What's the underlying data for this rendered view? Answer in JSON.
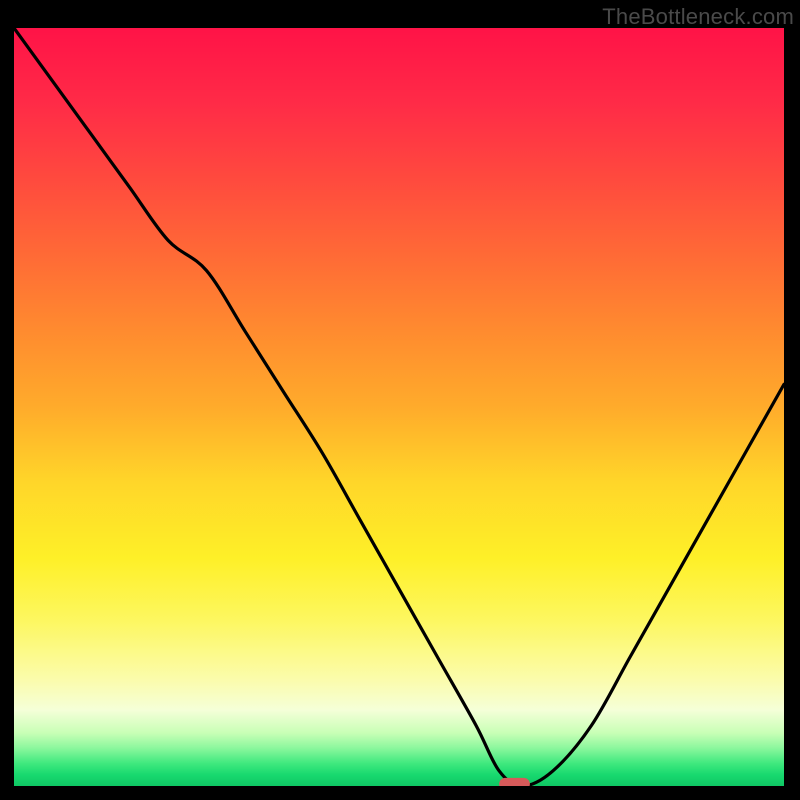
{
  "watermark": "TheBottleneck.com",
  "colors": {
    "frame_bg": "#000000",
    "curve_stroke": "#000000",
    "marker_fill": "#d65a5a",
    "gradient_stops": [
      "#ff1347",
      "#ff2b47",
      "#ff4a3e",
      "#ff6a36",
      "#ff8b2f",
      "#ffab2b",
      "#ffd629",
      "#fef028",
      "#fdf75f",
      "#fbfcac",
      "#f5ffd8",
      "#c8ffb6",
      "#8bf79d",
      "#40e97e",
      "#18d96f",
      "#0fc764"
    ]
  },
  "chart_data": {
    "type": "line",
    "title": "",
    "xlabel": "",
    "ylabel": "",
    "xlim": [
      0,
      100
    ],
    "ylim": [
      0,
      100
    ],
    "grid": false,
    "legend": null,
    "annotations": [],
    "series": [
      {
        "name": "bottleneck-curve",
        "x": [
          0,
          5,
          10,
          15,
          20,
          25,
          30,
          35,
          40,
          45,
          50,
          55,
          60,
          63,
          66,
          70,
          75,
          80,
          85,
          90,
          95,
          100
        ],
        "y": [
          100,
          93,
          86,
          79,
          72,
          68,
          60,
          52,
          44,
          35,
          26,
          17,
          8,
          2,
          0,
          2,
          8,
          17,
          26,
          35,
          44,
          53
        ]
      }
    ],
    "marker": {
      "name": "min-point",
      "shape": "pill",
      "x": 65,
      "y": 0,
      "approx_width_pct": 4,
      "approx_height_pct": 1.6
    }
  }
}
